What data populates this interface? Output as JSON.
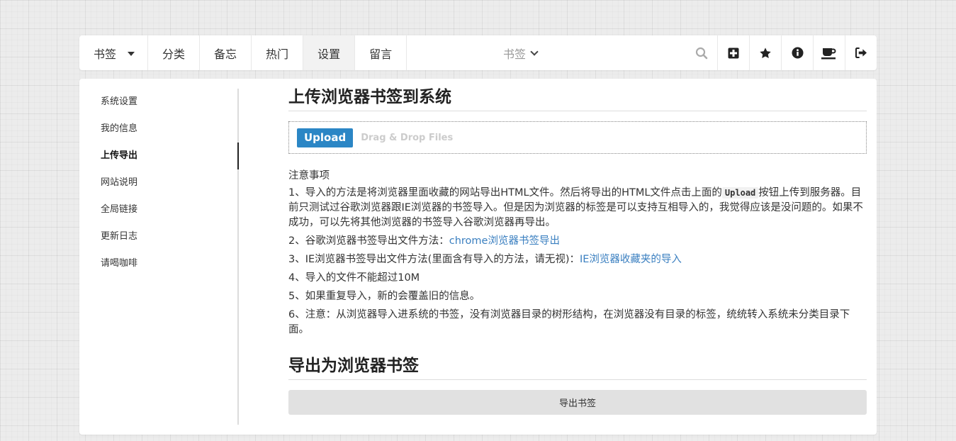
{
  "nav": {
    "menu": [
      {
        "label": "书签",
        "name": "nav-bookmarks",
        "dropdown": true
      },
      {
        "label": "分类",
        "name": "nav-categories"
      },
      {
        "label": "备忘",
        "name": "nav-memo"
      },
      {
        "label": "热门",
        "name": "nav-hot"
      },
      {
        "label": "设置",
        "name": "nav-settings",
        "active": true
      },
      {
        "label": "留言",
        "name": "nav-messages"
      }
    ],
    "search_scope": "书签",
    "icons": [
      "search-icon",
      "plus-square-icon",
      "star-icon",
      "info-circle-icon",
      "coffee-icon",
      "sign-out-icon"
    ]
  },
  "sidebar": {
    "items": [
      {
        "label": "系统设置"
      },
      {
        "label": "我的信息"
      },
      {
        "label": "上传导出",
        "active": true
      },
      {
        "label": "网站说明"
      },
      {
        "label": "全局链接"
      },
      {
        "label": "更新日志"
      },
      {
        "label": "请喝咖啡"
      }
    ]
  },
  "upload_section": {
    "title": "上传浏览器书签到系统",
    "button_label": "Upload",
    "drag_hint": "Drag & Drop Files"
  },
  "notes": {
    "heading": "注意事项",
    "n1_before": "1、导入的方法是将浏览器里面收藏的网站导出HTML文件。然后将导出的HTML文件点击上面的",
    "n1_code": "Upload",
    "n1_after": "按钮上传到服务器。目前只测试过谷歌浏览器跟IE浏览器的书签导入。但是因为浏览器的标签是可以支持互相导入的，我觉得应该是没问题的。如果不成功，可以先将其他浏览器的书签导入谷歌浏览器再导出。",
    "n2_text": "2、谷歌浏览器书签导出文件方法：",
    "n2_link": "chrome浏览器书签导出",
    "n3_text": "3、IE浏览器书签导出文件方法(里面含有导入的方法，请无视)：",
    "n3_link": "IE浏览器收藏夹的导入",
    "n4": "4、导入的文件不能超过10M",
    "n5": "5、如果重复导入，新的会覆盖旧的信息。",
    "n6": "6、注意：从浏览器导入进系统的书签，没有浏览器目录的树形结构，在浏览器没有目录的标签，统统转入系统未分类目录下面。"
  },
  "export_section": {
    "title": "导出为浏览器书签",
    "button_label": "导出书签"
  },
  "colors": {
    "accent": "#2b86c5",
    "link": "#3a7fc0"
  }
}
